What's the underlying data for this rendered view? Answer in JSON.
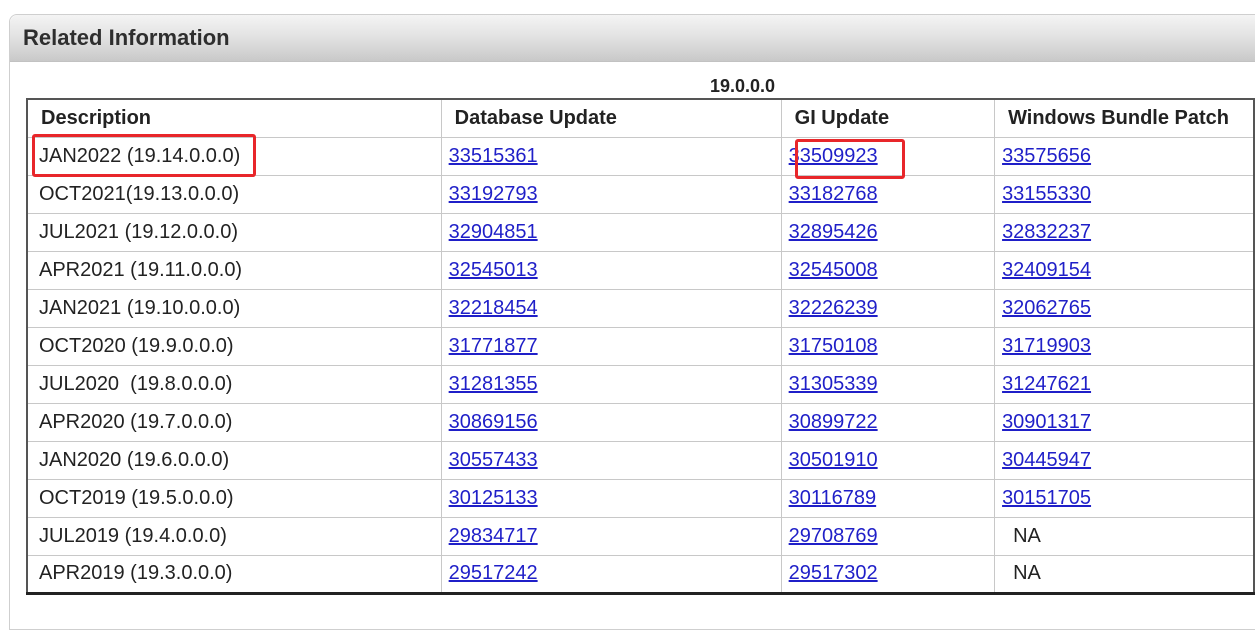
{
  "panel": {
    "title": "Related Information"
  },
  "table": {
    "version": "19.0.0.0",
    "headers": [
      "Description",
      "Database Update",
      "GI Update",
      "Windows Bundle Patch"
    ],
    "rows": [
      {
        "description": "JAN2022 (19.14.0.0.0)",
        "db": "33515361",
        "gi": "33509923",
        "win": "33575656"
      },
      {
        "description": "OCT2021(19.13.0.0.0)",
        "db": "33192793",
        "gi": "33182768",
        "win": "33155330"
      },
      {
        "description": "JUL2021 (19.12.0.0.0)",
        "db": "32904851",
        "gi": "32895426",
        "win": "32832237"
      },
      {
        "description": "APR2021 (19.11.0.0.0)",
        "db": "32545013",
        "gi": "32545008",
        "win": "32409154"
      },
      {
        "description": "JAN2021 (19.10.0.0.0)",
        "db": "32218454",
        "gi": "32226239",
        "win": "32062765"
      },
      {
        "description": "OCT2020 (19.9.0.0.0)",
        "db": "31771877",
        "gi": "31750108",
        "win": "31719903"
      },
      {
        "description": "JUL2020  (19.8.0.0.0)",
        "db": "31281355",
        "gi": "31305339",
        "win": "31247621"
      },
      {
        "description": "APR2020 (19.7.0.0.0)",
        "db": "30869156",
        "gi": "30899722",
        "win": "30901317"
      },
      {
        "description": "JAN2020 (19.6.0.0.0)",
        "db": "30557433",
        "gi": "30501910",
        "win": "30445947"
      },
      {
        "description": "OCT2019 (19.5.0.0.0)",
        "db": "30125133",
        "gi": "30116789",
        "win": "30151705"
      },
      {
        "description": "JUL2019 (19.4.0.0.0)",
        "db": "29834717",
        "gi": "29708769",
        "win": "NA"
      },
      {
        "description": "APR2019 (19.3.0.0.0)",
        "db": "29517242",
        "gi": "29517302",
        "win": "NA"
      }
    ]
  },
  "colors": {
    "link": "#1f1fc8",
    "highlight": "#e8262a",
    "header_gradient_top": "#f4f4f4",
    "header_gradient_bottom": "#c9c9c9"
  }
}
